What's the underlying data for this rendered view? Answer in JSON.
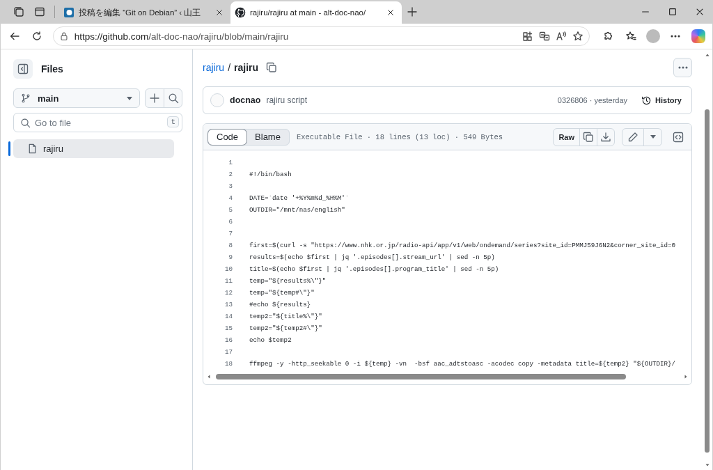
{
  "browser": {
    "tabs": [
      {
        "kind": "blog",
        "title": "投稿を編集 “Git on Debian” ‹ 山王",
        "selected": false
      },
      {
        "kind": "code-host",
        "title": "rajiru/rajiru at main - alt-doc-nao/",
        "selected": true
      }
    ],
    "url": {
      "host": "https://github.com",
      "path": "/alt-doc-nao/rajiru/blob/main/rajiru"
    }
  },
  "sidebar": {
    "title": "Files",
    "branch": "main",
    "search": {
      "placeholder": "Go to file",
      "shortcut": "t"
    },
    "files": [
      {
        "name": "rajiru",
        "selected": true
      }
    ]
  },
  "breadcrumb": {
    "repo": "rajiru",
    "separator": "/",
    "file": "rajiru"
  },
  "commit": {
    "author": "docnao",
    "message": "rajiru script",
    "sha_time": "0326806 · yesterday",
    "history": "History"
  },
  "file_header": {
    "view_tabs": [
      {
        "label": "Code",
        "selected": true
      },
      {
        "label": "Blame",
        "selected": false
      }
    ],
    "info": "Executable File · 18 lines (13 loc) · 549 Bytes",
    "raw": "Raw"
  },
  "code": {
    "lines": [
      {
        "number": "1"
      },
      {
        "number": "2",
        "text": "#!/bin/bash"
      },
      {
        "number": "3"
      },
      {
        "number": "4",
        "text": "DATE=`date '+%Y%m%d_%H%M'`"
      },
      {
        "number": "5",
        "text": "OUTDIR=\"/mnt/nas/english\""
      },
      {
        "number": "6"
      },
      {
        "number": "7"
      },
      {
        "number": "8",
        "text": "first=$(curl -s \"https://www.nhk.or.jp/radio-api/app/v1/web/ondemand/series?site_id=PMMJ59J6N2&corner_site_id=0"
      },
      {
        "number": "9",
        "text": "results=$(echo $first | jq '.episodes[].stream_url' | sed -n 5p)"
      },
      {
        "number": "10",
        "text": "title=$(echo $first | jq '.episodes[].program_title' | sed -n 5p)"
      },
      {
        "number": "11",
        "text": "temp=\"${results%\\\"}\""
      },
      {
        "number": "12",
        "text": "temp=\"${temp#\\\"}\""
      },
      {
        "number": "13",
        "text": "#echo ${results}"
      },
      {
        "number": "14",
        "text": "temp2=\"${title%\\\"}\""
      },
      {
        "number": "15",
        "text": "temp2=\"${temp2#\\\"}\""
      },
      {
        "number": "16",
        "text": "echo $temp2"
      },
      {
        "number": "17"
      },
      {
        "number": "18",
        "text": "ffmpeg -y -http_seekable 0 -i ${temp} -vn  -bsf aac_adtstoasc -acodec copy -metadata title=${temp2} \"${OUTDIR}/"
      }
    ]
  }
}
